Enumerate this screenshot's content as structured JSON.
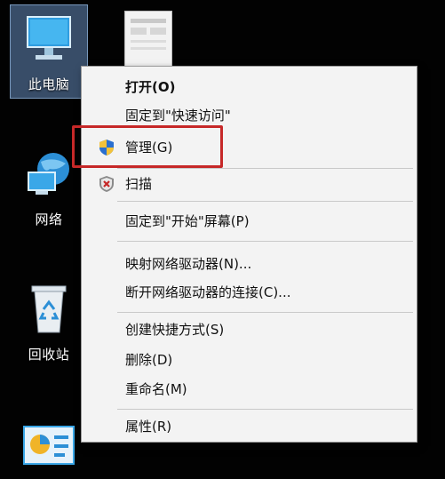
{
  "desktop": {
    "icons": [
      {
        "label": "此电脑",
        "icon": "this-pc-icon"
      },
      {
        "label": "网络",
        "icon": "network-icon"
      },
      {
        "label": "回收站",
        "icon": "recycle-bin-icon"
      },
      {
        "label": "",
        "icon": "control-panel-icon"
      }
    ]
  },
  "context_menu": {
    "items": [
      {
        "label": "打开(O)",
        "bold": true
      },
      {
        "label": "固定到\"快速访问\""
      },
      {
        "label": "管理(G)",
        "icon": "uac-shield-icon",
        "highlighted": true
      },
      {
        "label": "扫描",
        "icon": "antivirus-shield-icon"
      },
      {
        "label": "固定到\"开始\"屏幕(P)"
      },
      {
        "label": "映射网络驱动器(N)..."
      },
      {
        "label": "断开网络驱动器的连接(C)..."
      },
      {
        "label": "创建快捷方式(S)"
      },
      {
        "label": "删除(D)"
      },
      {
        "label": "重命名(M)"
      },
      {
        "label": "属性(R)"
      }
    ]
  },
  "colors": {
    "highlight_box": "#c62828",
    "menu_background": "#f3f3f3",
    "desktop_background": "#020202"
  }
}
